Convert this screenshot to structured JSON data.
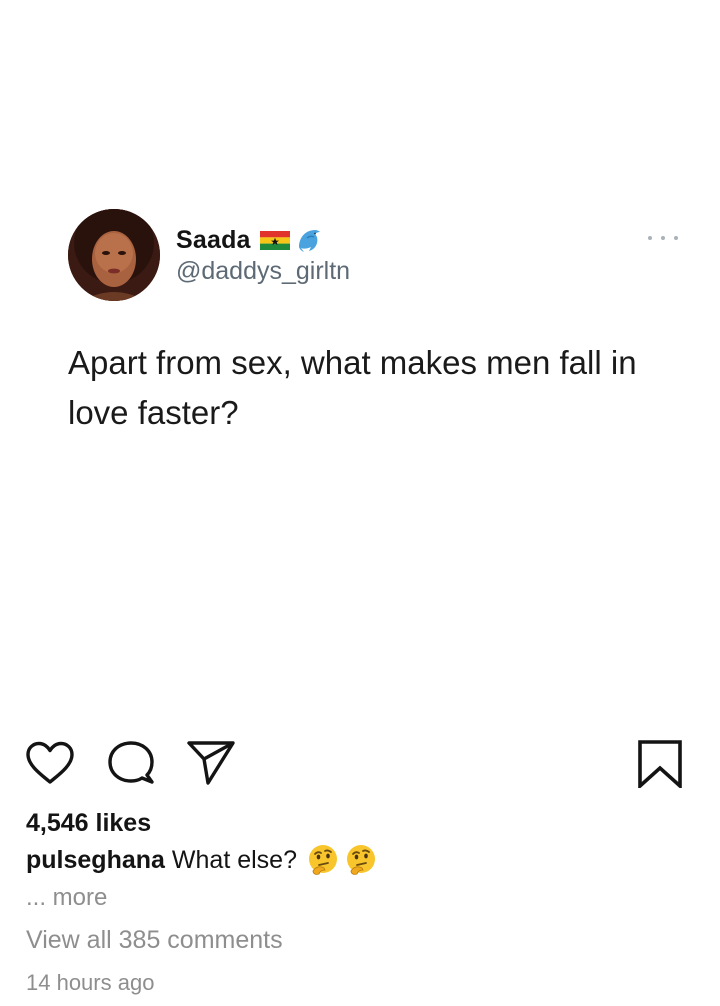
{
  "tweet": {
    "display_name": "Saada",
    "handle": "@daddys_girltn",
    "text": "Apart from sex, what makes men fall in love faster?",
    "name_icons": [
      "ghana-flag-icon",
      "dolphin-icon"
    ],
    "more_icon": "more-dots-icon"
  },
  "post": {
    "likes": "4,546 likes",
    "caption_user": "pulseghana",
    "caption_text": "What else?",
    "caption_emojis": [
      "thinking-face-icon",
      "thinking-face-icon"
    ],
    "more_label": "... more",
    "view_comments": "View all 385 comments",
    "timestamp": "14 hours ago"
  },
  "actions": {
    "icons": [
      "heart-icon",
      "comment-icon",
      "share-icon",
      "bookmark-icon"
    ]
  },
  "colors": {
    "text_primary": "#141414",
    "text_secondary": "#5d6a75",
    "text_muted": "#8e8e8e",
    "background": "#ffffff"
  }
}
